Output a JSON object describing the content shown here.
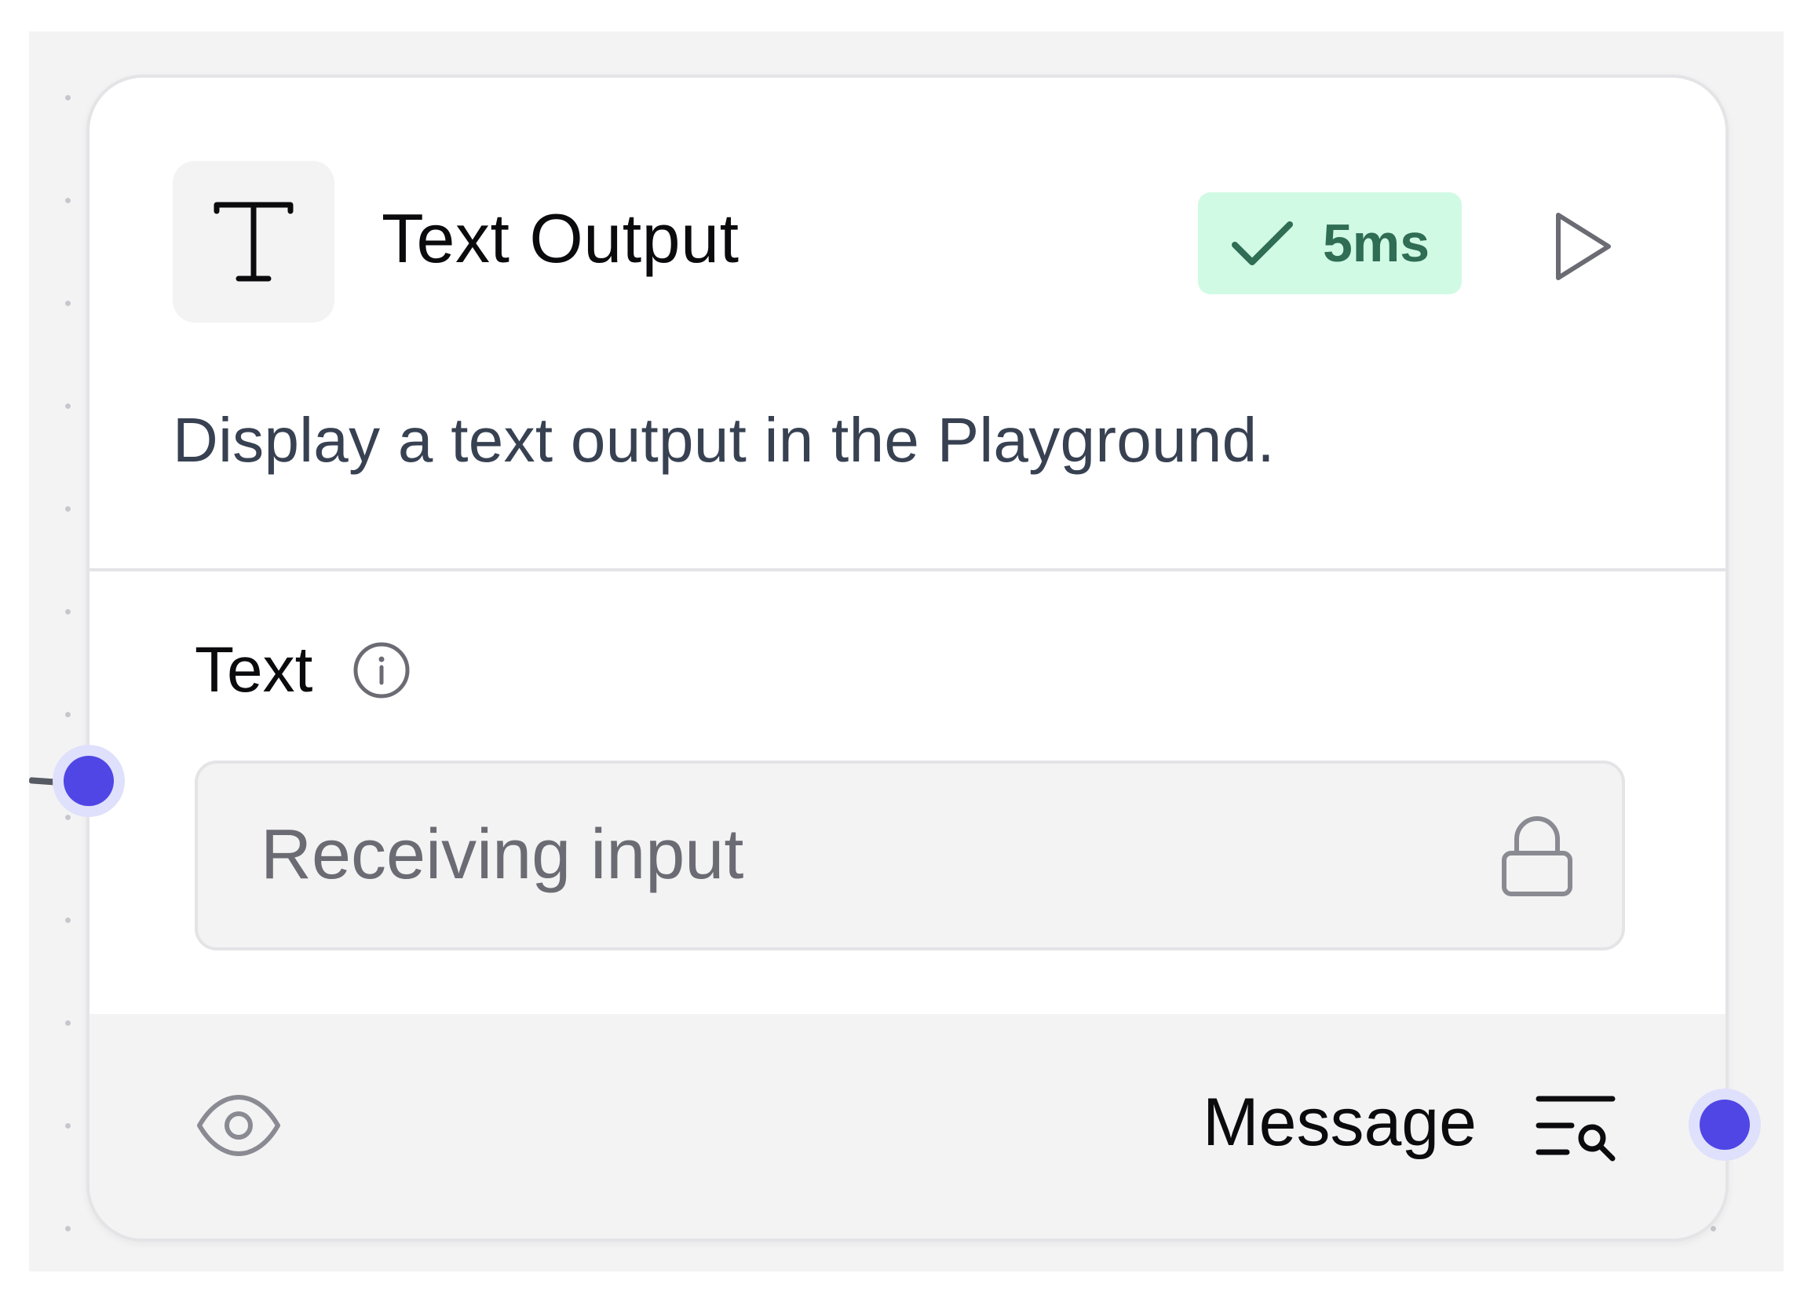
{
  "node": {
    "icon": "text-T-icon",
    "title": "Text Output",
    "status": {
      "icon": "check-icon",
      "duration": "5ms",
      "color": "#2f6d55",
      "background": "#d1fae5"
    },
    "run_icon": "play-icon",
    "description": "Display a text output in the Playground."
  },
  "field": {
    "label": "Text",
    "info_icon": "info-icon",
    "placeholder": "Receiving input",
    "lock_icon": "lock-icon"
  },
  "footer": {
    "visibility_icon": "eye-icon",
    "output_label": "Message",
    "inspect_icon": "inspect-output-icon"
  },
  "colors": {
    "handle": "#4f46e5",
    "handle_ring": "#dfe0fb",
    "canvas": "#f3f3f4"
  }
}
